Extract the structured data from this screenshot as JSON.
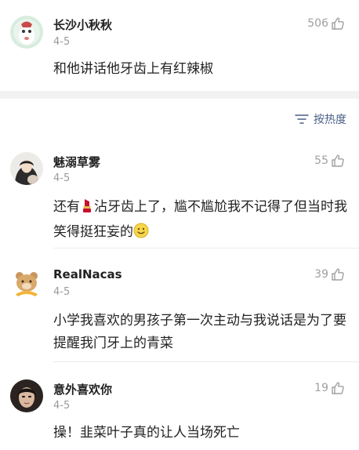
{
  "pinned_comment": {
    "username": "长沙小秋秋",
    "date": "4-5",
    "likes": "506",
    "text": "和他讲话他牙齿上有红辣椒"
  },
  "sort": {
    "icon": "sort-lines-icon",
    "label": "按热度"
  },
  "comments": [
    {
      "username": "魅溺草雾",
      "date": "4-5",
      "likes": "55",
      "text_before_icon": "还有",
      "inline_icon": "lipstick-icon",
      "text_after_icon": "沾牙齿上了，尴不尴尬我不记得了但当时我笑得挺狂妄的",
      "trailing_emoji": "smile-emoji-icon"
    },
    {
      "username": "RealNacas",
      "date": "4-5",
      "likes": "39",
      "text": "小学我喜欢的男孩子第一次主动与我说话是为了要提醒我门牙上的青菜"
    },
    {
      "username": "意外喜欢你",
      "date": "4-5",
      "likes": "19",
      "text": "操！韭菜叶子真的让人当场死亡"
    }
  ],
  "colors": {
    "meta_gray": "#9a9a9a",
    "sort_blue": "#4a5f87",
    "separator": "#f2f2f2"
  }
}
